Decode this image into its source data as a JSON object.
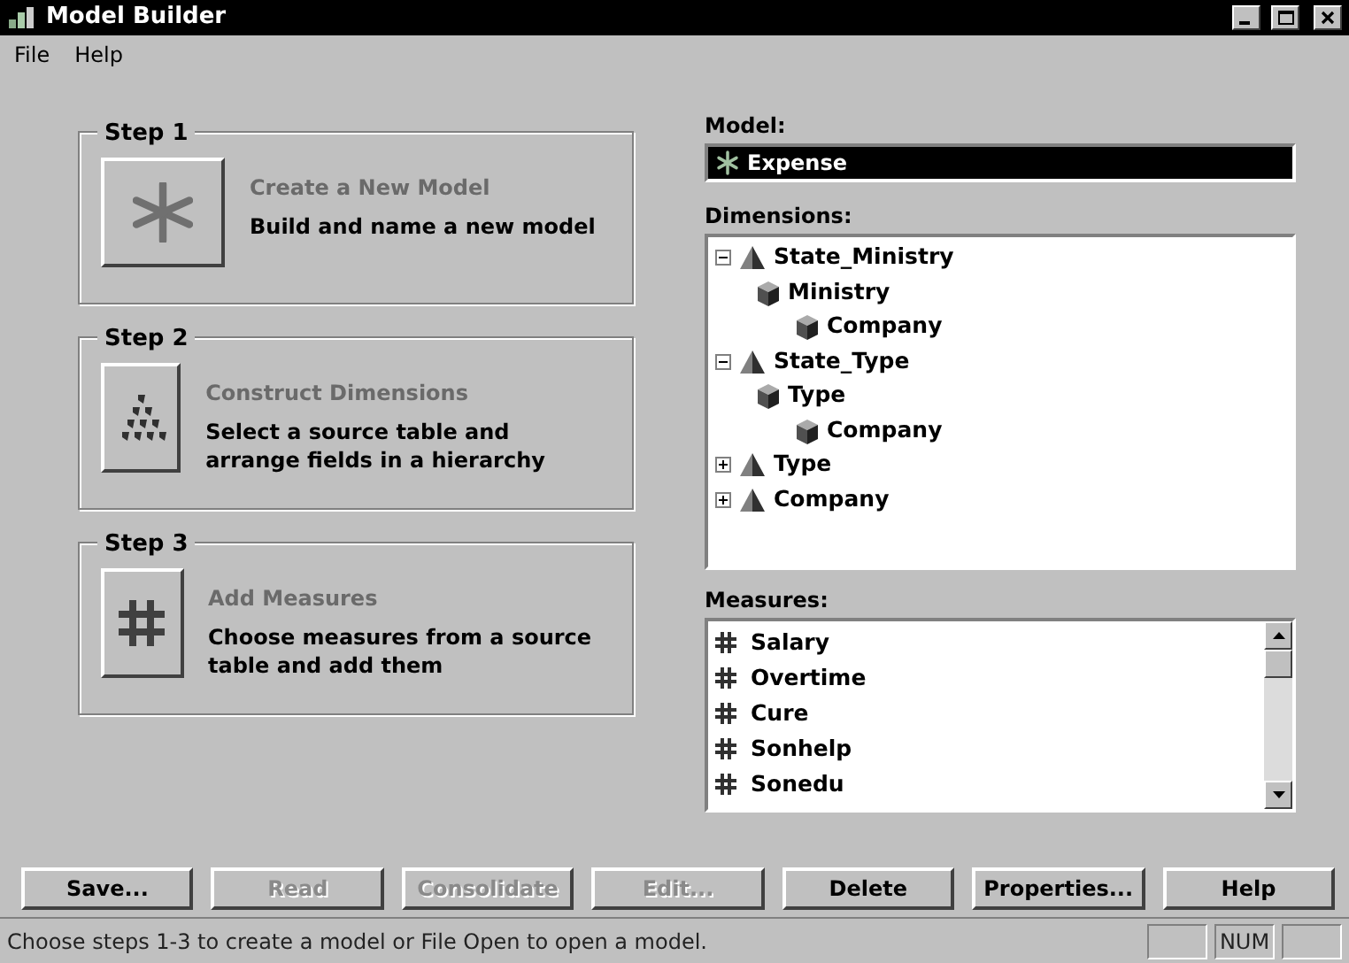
{
  "window": {
    "title": "Model Builder"
  },
  "menu": [
    "File",
    "Help"
  ],
  "steps": [
    {
      "legend": "Step 1",
      "kind": "asterisk",
      "title": "Create a New Model",
      "description": "Build and name a new model",
      "enabled": false
    },
    {
      "legend": "Step 2",
      "kind": "dots",
      "title": "Construct Dimensions",
      "description": "Select a source table and arrange fields in a hierarchy",
      "enabled": false
    },
    {
      "legend": "Step 3",
      "kind": "hash",
      "title": "Add Measures",
      "description": "Choose measures from a source table and add them",
      "enabled": false
    }
  ],
  "model": {
    "label": "Model:",
    "value": "Expense",
    "selected": true
  },
  "dimensions": {
    "label": "Dimensions:",
    "items": [
      {
        "label": "State_Ministry",
        "kind": "hierarchy",
        "expanded": true,
        "children": [
          {
            "label": "Ministry",
            "kind": "level",
            "children": [
              {
                "label": "Company",
                "kind": "level"
              }
            ]
          }
        ]
      },
      {
        "label": "State_Type",
        "kind": "hierarchy",
        "expanded": true,
        "children": [
          {
            "label": "Type",
            "kind": "level",
            "children": [
              {
                "label": "Company",
                "kind": "level"
              }
            ]
          }
        ]
      },
      {
        "label": "Type",
        "kind": "hierarchy",
        "expanded": false
      },
      {
        "label": "Company",
        "kind": "hierarchy",
        "expanded": false
      }
    ]
  },
  "measures": {
    "label": "Measures:",
    "items": [
      "Salary",
      "Overtime",
      "Cure",
      "Sonhelp",
      "Sonedu"
    ]
  },
  "buttons": [
    {
      "label": "Save...",
      "disabled": false
    },
    {
      "label": "Read",
      "disabled": true
    },
    {
      "label": "Consolidate",
      "disabled": true
    },
    {
      "label": "Edit...",
      "disabled": true
    },
    {
      "label": "Delete",
      "disabled": false
    },
    {
      "label": "Properties...",
      "disabled": false
    },
    {
      "label": "Help",
      "disabled": false
    }
  ],
  "status_bar": {
    "message": "Choose steps 1-3 to create a model or File Open to open a model.",
    "indicator": "NUM"
  }
}
